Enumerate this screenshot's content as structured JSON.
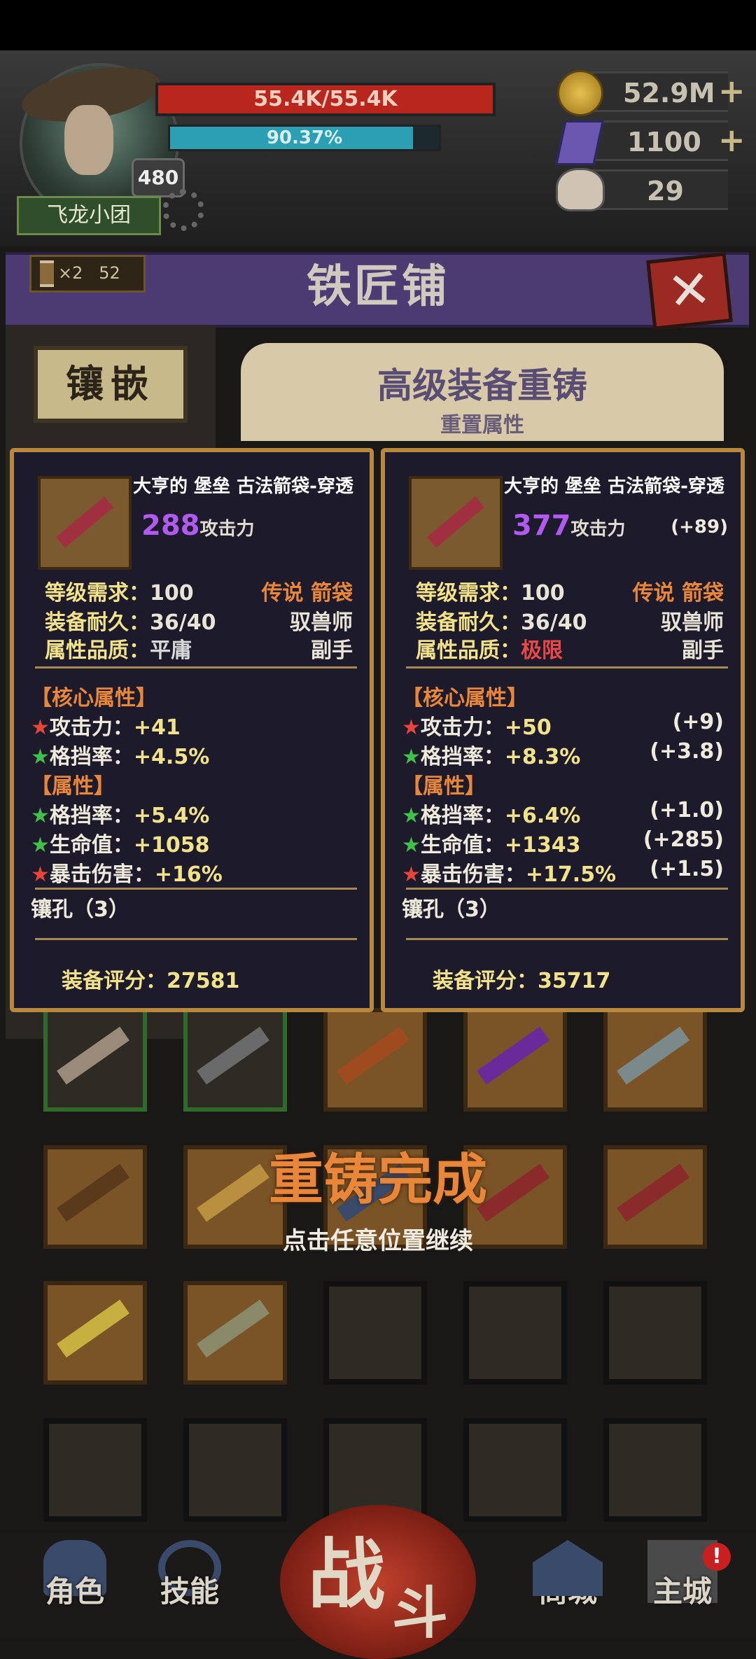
{
  "hud": {
    "hp_text": "55.4K/55.4K",
    "xp_text": "90.37%",
    "xp_fraction": 0.9037,
    "level": "480",
    "team_name": "飞龙小团",
    "gold": "52.9M",
    "gems": "1100",
    "horns": "29",
    "plus": "+"
  },
  "shop": {
    "title": "铁匠铺",
    "timer_mult": "×2",
    "timer_value": "52",
    "close": "✕",
    "inlay_tab": "镶嵌",
    "panel_title": "高级装备重铸",
    "panel_subtitle": "重置属性"
  },
  "cards": [
    {
      "name": "大亨的 堡垒 古法箭袋-穿透",
      "attack": "288",
      "attack_label": "攻击力",
      "attack_delta": "",
      "level_req_label": "等级需求：",
      "level_req": "100",
      "rarity": "传说 箭袋",
      "durability_label": "装备耐久：",
      "durability": "36/40",
      "class": "驭兽师",
      "quality_label": "属性品质：",
      "quality": "平庸",
      "slot": "副手",
      "core_head": "【核心属性】",
      "core": [
        {
          "star": "★",
          "label": "攻击力：",
          "value": "+41",
          "delta": ""
        },
        {
          "star": "★",
          "label": "格挡率：",
          "value": "+4.5%",
          "delta": ""
        }
      ],
      "attr_head": "【属性】",
      "attrs": [
        {
          "star": "★",
          "label": "格挡率：",
          "value": "+5.4%",
          "delta": ""
        },
        {
          "star": "★",
          "label": "生命值：",
          "value": "+1058",
          "delta": ""
        },
        {
          "star": "★",
          "label": "暴击伤害：",
          "value": "+16%",
          "delta": ""
        }
      ],
      "sockets": "镶孔（3）",
      "score_label": "装备评分：",
      "score": "27581"
    },
    {
      "name": "大亨的 堡垒 古法箭袋-穿透",
      "attack": "377",
      "attack_label": "攻击力",
      "attack_delta": "(+89)",
      "level_req_label": "等级需求：",
      "level_req": "100",
      "rarity": "传说 箭袋",
      "durability_label": "装备耐久：",
      "durability": "36/40",
      "class": "驭兽师",
      "quality_label": "属性品质：",
      "quality": "极限",
      "slot": "副手",
      "core_head": "【核心属性】",
      "core": [
        {
          "star": "★",
          "label": "攻击力：",
          "value": "+50",
          "delta": "(+9)"
        },
        {
          "star": "★",
          "label": "格挡率：",
          "value": "+8.3%",
          "delta": "(+3.8)"
        }
      ],
      "attr_head": "【属性】",
      "attrs": [
        {
          "star": "★",
          "label": "格挡率：",
          "value": "+6.4%",
          "delta": "(+1.0)"
        },
        {
          "star": "★",
          "label": "生命值：",
          "value": "+1343",
          "delta": "(+285)"
        },
        {
          "star": "★",
          "label": "暴击伤害：",
          "value": "+17.5%",
          "delta": "(+1.5)"
        }
      ],
      "sockets": "镶孔（3）",
      "score_label": "装备评分：",
      "score": "35717"
    }
  ],
  "overlay": {
    "title": "重铸完成",
    "hint": "点击任意位置继续"
  },
  "nav": {
    "character": "角色",
    "skills": "技能",
    "battle_1": "战",
    "battle_2": "斗",
    "shop": "商城",
    "city": "主城",
    "alert": "!"
  }
}
